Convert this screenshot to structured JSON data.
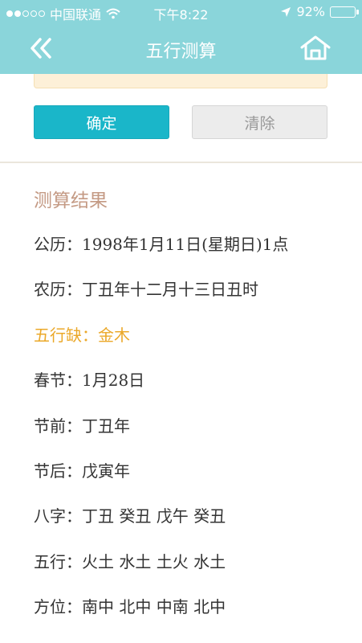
{
  "status_bar": {
    "carrier": "中国联通",
    "time": "下午8:22",
    "battery_text": "92%",
    "battery_level": 0.92
  },
  "nav": {
    "title": "五行测算",
    "back_icon": "double-chevron-left-icon",
    "home_icon": "home-icon"
  },
  "actions": {
    "confirm_label": "确定",
    "clear_label": "清除"
  },
  "result": {
    "title": "测算结果",
    "rows": [
      {
        "label": "公历：",
        "value": "1998年1月11日(星期日)1点"
      },
      {
        "label": "农历：",
        "value": "丁丑年十二月十三日丑时"
      },
      {
        "label": "五行缺：",
        "value": "金木"
      },
      {
        "label": "春节：",
        "value": "1月28日"
      },
      {
        "label": "节前：",
        "value": "丁丑年"
      },
      {
        "label": "节后：",
        "value": "戊寅年"
      },
      {
        "label": "八字：",
        "value": "丁丑 癸丑 戊午 癸丑"
      },
      {
        "label": "五行：",
        "value": "火土 水土 土火 水土"
      },
      {
        "label": "方位：",
        "value": "南中 北中 中南 北中"
      }
    ]
  },
  "colors": {
    "header_bg": "#8ad5da",
    "confirm_bg": "#1ab6c9",
    "accent": "#eba829",
    "section_title": "#c49a84"
  }
}
